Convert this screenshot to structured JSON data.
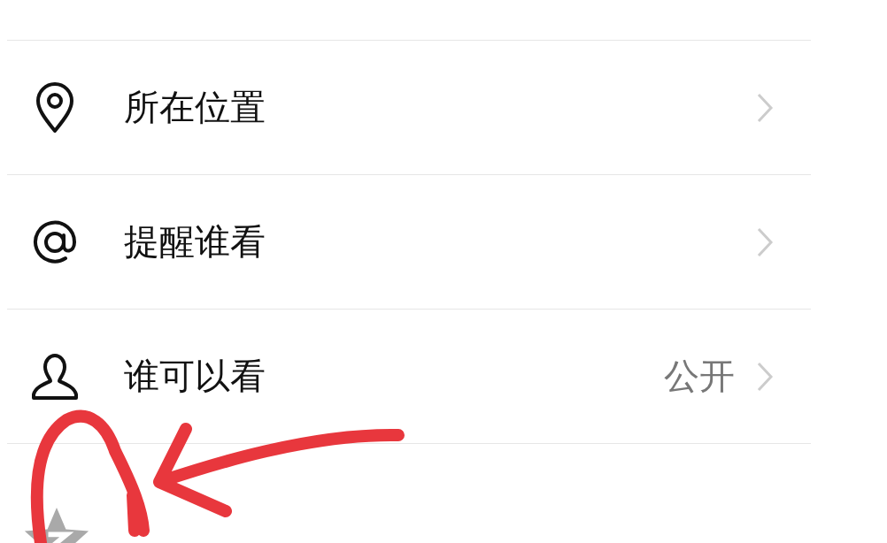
{
  "rows": [
    {
      "kind": "location",
      "label": "所在位置",
      "chevron": true
    },
    {
      "kind": "mention",
      "label": "提醒谁看",
      "chevron": true
    },
    {
      "kind": "audience",
      "label": "谁可以看",
      "value": "公开",
      "chevron": true
    },
    {
      "kind": "qzone",
      "chevron": false
    }
  ],
  "annotation": {
    "kind": "circle-arrow"
  }
}
